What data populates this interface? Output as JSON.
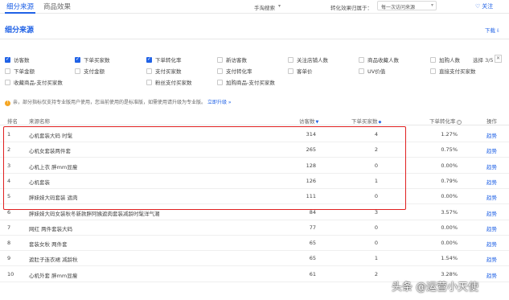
{
  "tabs": [
    {
      "label": "细分来源"
    },
    {
      "label": "商品效果"
    }
  ],
  "top": {
    "terminal_label": "手淘搜索",
    "attribution_label": "转化效果归属于：",
    "attribution_value": "每一次访问来源",
    "follow_label": "关注"
  },
  "section": {
    "title": "细分来源",
    "download_label": "下载"
  },
  "metrics": [
    {
      "label": "访客数",
      "checked": true
    },
    {
      "label": "下单买家数",
      "checked": true
    },
    {
      "label": "下单转化率",
      "checked": true
    },
    {
      "label": "新访客数",
      "checked": false
    },
    {
      "label": "关注店铺人数",
      "checked": false
    },
    {
      "label": "商品收藏人数",
      "checked": false
    },
    {
      "label": "加购人数",
      "checked": false
    },
    {
      "label": "下单金额",
      "checked": false
    },
    {
      "label": "支付金额",
      "checked": false
    },
    {
      "label": "支付买家数",
      "checked": false
    },
    {
      "label": "支付转化率",
      "checked": false
    },
    {
      "label": "客单价",
      "checked": false
    },
    {
      "label": "UV价值",
      "checked": false
    },
    {
      "label": "直接支付买家数",
      "checked": false
    },
    {
      "label": "收藏商品-支付买家数",
      "checked": false
    },
    {
      "label": "粉丝支付买家数",
      "checked": false
    },
    {
      "label": "加购商品-支付买家数",
      "checked": false
    }
  ],
  "selection": {
    "label": "选择 3/5"
  },
  "notice": {
    "text": "亲，部分指标仅支持专业版用户使用，您当前使用的是标准版，如需使用请升级为专业版。",
    "link": "立即升级 »"
  },
  "table": {
    "headers": {
      "rank": "排名",
      "source": "来源名称",
      "visitors": "访客数",
      "buyers": "下单买家数",
      "rate": "下单转化率",
      "op": "操作"
    },
    "rows": [
      {
        "rank": "1",
        "source": "心机套装大码 时髦",
        "visitors": "314",
        "buyers": "4",
        "rate": "1.27%",
        "op": "趋势"
      },
      {
        "rank": "2",
        "source": "心机女套装两件套",
        "visitors": "265",
        "buyers": "2",
        "rate": "0.75%",
        "op": "趋势"
      },
      {
        "rank": "3",
        "source": "心机上衣 胖mm显瘦",
        "visitors": "128",
        "buyers": "0",
        "rate": "0.00%",
        "op": "趋势"
      },
      {
        "rank": "4",
        "source": "心机套装",
        "visitors": "126",
        "buyers": "1",
        "rate": "0.79%",
        "op": "趋势"
      },
      {
        "rank": "5",
        "source": "胖妹妹大码套装 遮肉",
        "visitors": "111",
        "buyers": "0",
        "rate": "0.00%",
        "op": "趋势"
      },
      {
        "rank": "6",
        "source": "胖妹妹大码女装秋冬新款胖阿姨遮肉套装减龄时髦洋气潮",
        "visitors": "84",
        "buyers": "3",
        "rate": "3.57%",
        "op": "趋势"
      },
      {
        "rank": "7",
        "source": "网红 两件套装大码",
        "visitors": "77",
        "buyers": "0",
        "rate": "0.00%",
        "op": "趋势"
      },
      {
        "rank": "8",
        "source": "套装女秋 两件套",
        "visitors": "65",
        "buyers": "0",
        "rate": "0.00%",
        "op": "趋势"
      },
      {
        "rank": "9",
        "source": "遮肚子连衣裙 减龄秋",
        "visitors": "65",
        "buyers": "1",
        "rate": "1.54%",
        "op": "趋势"
      },
      {
        "rank": "10",
        "source": "心机外套 胖mm显瘦",
        "visitors": "61",
        "buyers": "2",
        "rate": "3.28%",
        "op": "趋势"
      }
    ]
  },
  "watermark": "头条 @运营小天使",
  "colors": {
    "accent": "#2062e6",
    "highlight": "#e02020"
  }
}
